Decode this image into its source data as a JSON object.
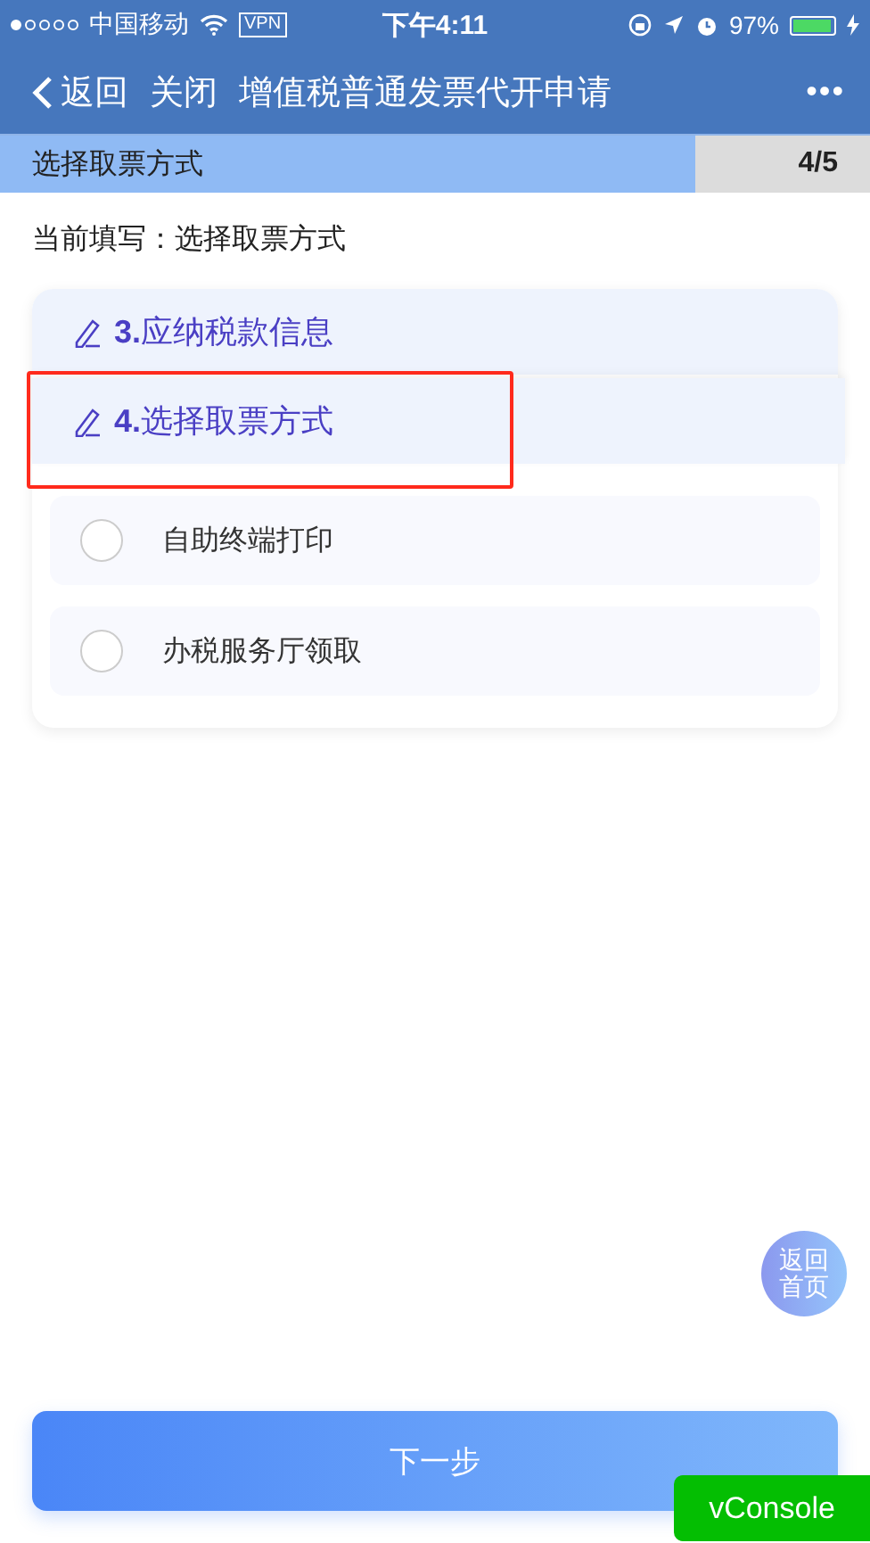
{
  "status_bar": {
    "carrier": "中国移动",
    "vpn": "VPN",
    "time": "下午4:11",
    "battery": "97%"
  },
  "nav": {
    "back": "返回",
    "close": "关闭",
    "title": "增值税普通发票代开申请",
    "more": "•••"
  },
  "progress": {
    "label": "选择取票方式",
    "count": "4/5",
    "level": 0.8
  },
  "current": "当前填写：选择取票方式",
  "sections": [
    {
      "number": "3.",
      "title": "应纳税款信息",
      "highlighted": false
    },
    {
      "number": "4.",
      "title": "选择取票方式",
      "highlighted": true,
      "options": [
        {
          "label": "自助终端打印",
          "selected": false
        },
        {
          "label": "办税服务厅领取",
          "selected": false
        }
      ]
    }
  ],
  "home_button": "返回首页",
  "next_button": "下一步",
  "console_button": "vConsole"
}
